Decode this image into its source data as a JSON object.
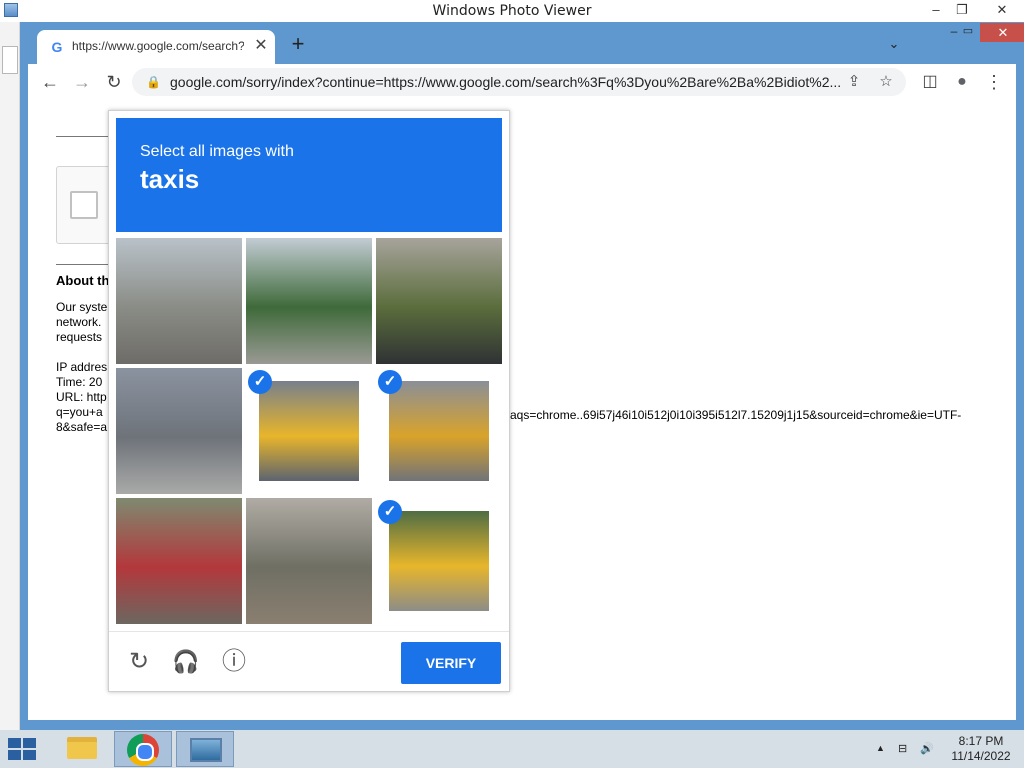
{
  "photo_viewer": {
    "title": "Windows Photo Viewer",
    "minimize": "–",
    "restore": "❐",
    "close": "✕"
  },
  "browser": {
    "tab": {
      "favicon": "G",
      "title": "https://www.google.com/search?q=you+are+a+bidiot",
      "close": "✕"
    },
    "new_tab": "+",
    "tab_search": "⌄",
    "window_min": "–",
    "window_max": "▭",
    "window_close": "✕",
    "toolbar": {
      "back": "←",
      "forward": "→",
      "reload": "↻",
      "lock": "🔒",
      "url": "google.com/sorry/index?continue=https://www.google.com/search%3Fq%3Dyou%2Bare%2Ba%2Bidiot%2...",
      "share": "⇪",
      "bookmark": "☆",
      "side_panel": "◫",
      "profile": "●",
      "menu": "⋮"
    }
  },
  "sorry_page": {
    "heading": "About th",
    "lines_1": [
      "Our syste",
      "network.",
      "requests"
    ],
    "lines_2": [
      "IP addres",
      "Time: 20",
      "URL: http",
      "q=you+a",
      "8&safe=a"
    ],
    "url_tail": "aqs=chrome..69i57j46i10i512j0i10i395i512l7.15209j1j15&sourceid=chrome&ie=UTF-"
  },
  "captcha": {
    "instruction": "Select all images with",
    "target": "taxis",
    "checkmark": "✓",
    "tiles": [
      {
        "label": "street",
        "selected": false,
        "colors": [
          "#b9c2c9",
          "#8a8c86",
          "#6e6c68"
        ]
      },
      {
        "label": "traffic-light",
        "selected": false,
        "colors": [
          "#c3ccd4",
          "#3f6a3a",
          "#9a9a94"
        ]
      },
      {
        "label": "parked-car",
        "selected": false,
        "colors": [
          "#a7a49c",
          "#5b6d3c",
          "#2f3234"
        ]
      },
      {
        "label": "crosswalk",
        "selected": false,
        "colors": [
          "#8b93a0",
          "#6e737a",
          "#a9aaa8"
        ]
      },
      {
        "label": "taxi-1",
        "selected": true,
        "colors": [
          "#77808c",
          "#e8b52b",
          "#5c6470"
        ]
      },
      {
        "label": "taxi-2",
        "selected": true,
        "colors": [
          "#8a8f98",
          "#d9a32a",
          "#707379"
        ]
      },
      {
        "label": "motorcycles",
        "selected": false,
        "colors": [
          "#7e8a70",
          "#b3383c",
          "#6c6760"
        ]
      },
      {
        "label": "street-2",
        "selected": false,
        "colors": [
          "#b0aca5",
          "#6f6f64",
          "#8a7f70"
        ]
      },
      {
        "label": "taxi-3",
        "selected": true,
        "colors": [
          "#4f6d44",
          "#e7b62b",
          "#8d8d88"
        ]
      }
    ],
    "reload_icon": "↻",
    "audio_icon": "🎧",
    "info_icon": "ⓘ",
    "verify": "VERIFY"
  },
  "taskbar": {
    "tray_arrow": "▲",
    "network": "⊟",
    "volume": "🔊",
    "time": "8:17 PM",
    "date": "11/14/2022"
  }
}
